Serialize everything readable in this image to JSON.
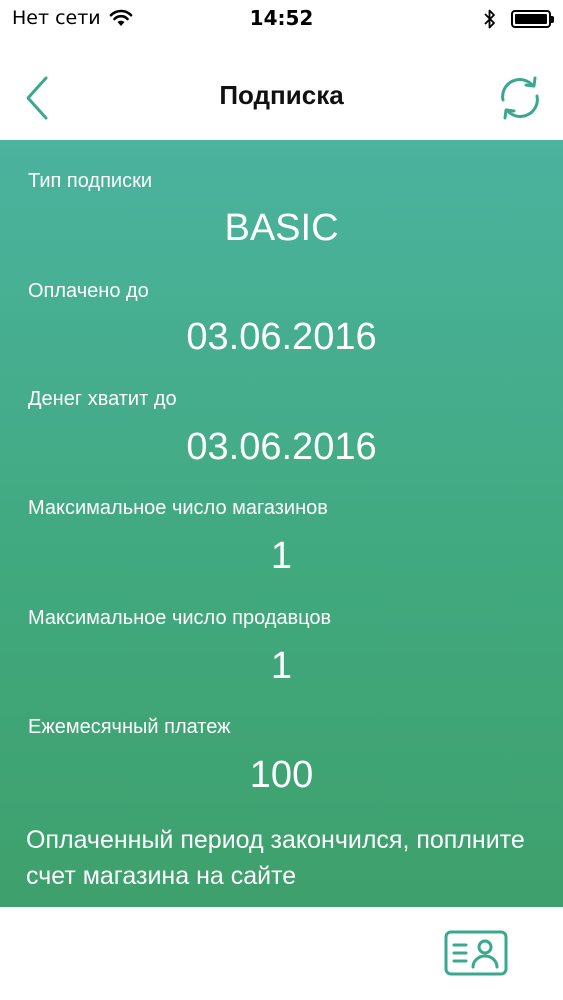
{
  "status_bar": {
    "carrier": "Нет сети",
    "time": "14:52",
    "icons": [
      "wifi-icon",
      "bluetooth-icon",
      "battery-icon"
    ]
  },
  "nav": {
    "title": "Подписка",
    "back_icon": "chevron-left-icon",
    "refresh_icon": "refresh-icon"
  },
  "subscription": {
    "type_label": "Тип подписки",
    "type_value": "BASIC",
    "paid_until_label": "Оплачено до",
    "paid_until_value": "03.06.2016",
    "money_until_label": "Денег хватит до",
    "money_until_value": "03.06.2016",
    "max_shops_label": "Максимальное число магазинов",
    "max_shops_value": "1",
    "max_sellers_label": "Максимальное число продавцов",
    "max_sellers_value": "1",
    "monthly_payment_label": "Ежемесячный платеж",
    "monthly_payment_value": "100",
    "notice": "Оплаченный период закончился, поплните счет магазина на сайте"
  },
  "tabbar": {
    "profile_icon": "profile-card-icon"
  },
  "colors": {
    "accent": "#3aa88e",
    "gradient_top": "#4bb39e",
    "gradient_bottom": "#3ea06c"
  }
}
